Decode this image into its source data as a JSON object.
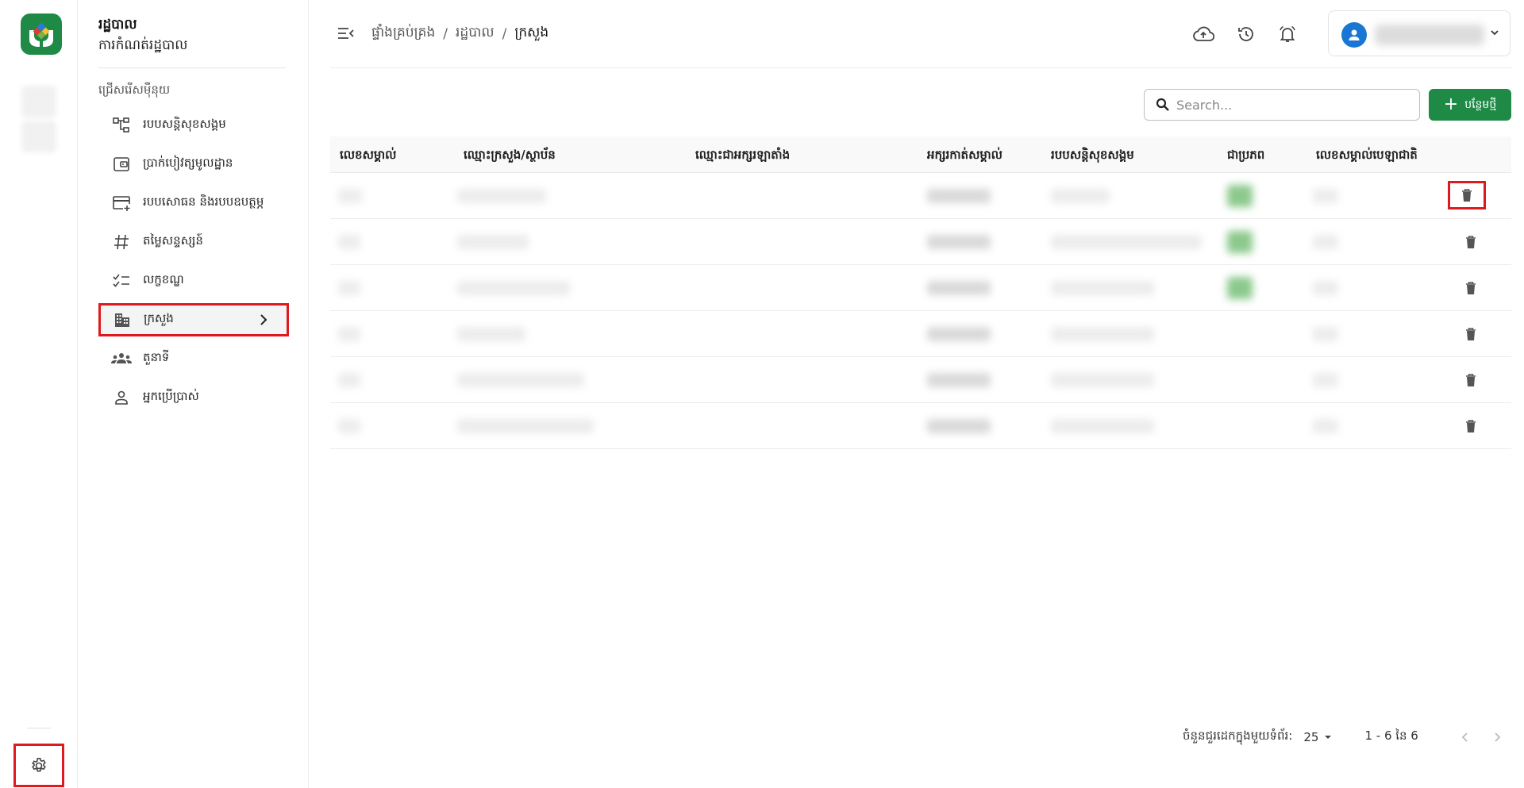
{
  "sidebar": {
    "title": "រដ្ឋបាល",
    "subtitle": "ការកំណត់រដ្ឋបាល",
    "section_label": "ជ្រើសរើសម៉ឺនុយ",
    "items": [
      {
        "label": "របបសន្តិសុខសង្គម",
        "icon": "hierarchy-icon"
      },
      {
        "label": "ប្រាក់បៀវត្សមូលដ្ឋាន",
        "icon": "wallet-icon"
      },
      {
        "label": "របបសោធន និងរបបឧបត្ថម្ភ",
        "icon": "card-add-icon"
      },
      {
        "label": "តម្លៃសន្ទស្សន៍",
        "icon": "hash-icon"
      },
      {
        "label": "លក្ខខណ្ឌ",
        "icon": "checklist-icon"
      },
      {
        "label": "ក្រសួង",
        "icon": "building-icon"
      },
      {
        "label": "តួនាទី",
        "icon": "group-icon"
      },
      {
        "label": "អ្នកប្រើប្រាស់",
        "icon": "person-icon"
      }
    ]
  },
  "header": {
    "breadcrumb": [
      "ផ្ទាំងគ្រប់គ្រង",
      "រដ្ឋបាល",
      "ក្រសួង"
    ]
  },
  "toolbar": {
    "search_placeholder": "Search...",
    "add_label": "បន្ថែមថ្មី"
  },
  "table": {
    "columns": [
      "លេខសម្គាល់",
      "ឈ្មោះក្រសួង/ស្ថាប័ន",
      "ឈ្មោះជាអក្សរឡាតាំង",
      "អក្សរកាត់សម្គាល់",
      "របបសន្តិសុខសង្គម",
      "ជាប្រភព",
      "លេខសម្គាល់បេឡាជាតិ"
    ],
    "row_count": 6
  },
  "pager": {
    "rows_per_page_label": "ចំនួនជួរដេកក្នុងមួយទំព័រ:",
    "rows_per_page": "25",
    "range": "1 - 6 នៃ 6"
  },
  "colors": {
    "brand_green": "#1e8a46",
    "highlight_red": "#e0191e",
    "avatar_blue": "#1976d2"
  }
}
